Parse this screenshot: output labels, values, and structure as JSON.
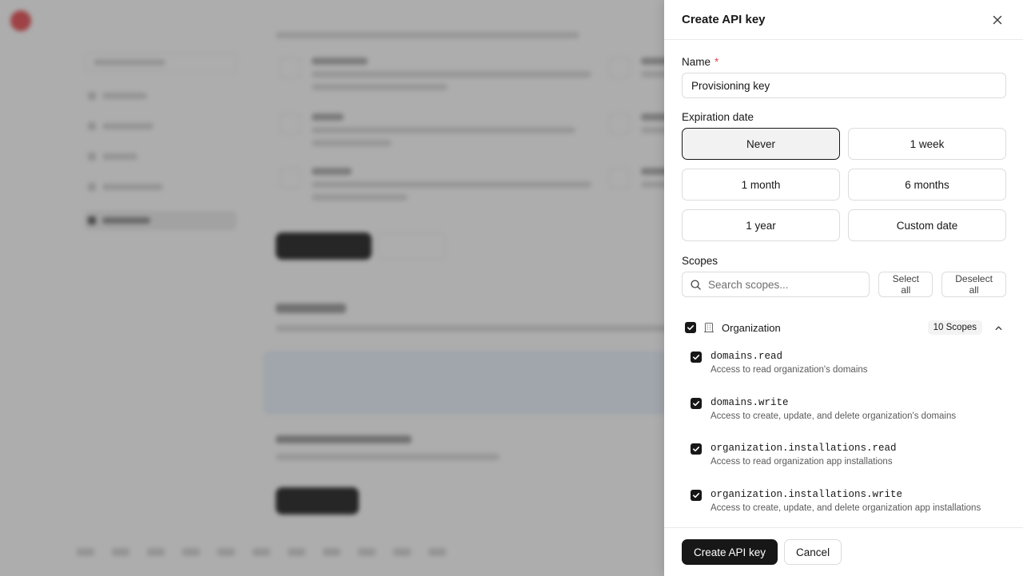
{
  "drawer": {
    "title": "Create API key",
    "close_icon": "close-icon"
  },
  "name_field": {
    "label": "Name",
    "required_mark": "*",
    "value": "Provisioning key"
  },
  "expiration": {
    "label": "Expiration date",
    "options": [
      {
        "label": "Never",
        "selected": true
      },
      {
        "label": "1 week",
        "selected": false
      },
      {
        "label": "1 month",
        "selected": false
      },
      {
        "label": "6 months",
        "selected": false
      },
      {
        "label": "1 year",
        "selected": false
      },
      {
        "label": "Custom date",
        "selected": false
      }
    ]
  },
  "scopes": {
    "label": "Scopes",
    "search_placeholder": "Search scopes...",
    "select_all": "Select all",
    "deselect_all": "Deselect all",
    "group": {
      "name": "Organization",
      "count": "10 Scopes",
      "icon": "building-icon",
      "checked": true,
      "expanded": true,
      "items": [
        {
          "name": "domains.read",
          "description": "Access to read organization's domains",
          "checked": true
        },
        {
          "name": "domains.write",
          "description": "Access to create, update, and delete organization's domains",
          "checked": true
        },
        {
          "name": "organization.installations.read",
          "description": "Access to read organization app installations",
          "checked": true
        },
        {
          "name": "organization.installations.write",
          "description": "Access to create, update, and delete organization app installations",
          "checked": true
        }
      ]
    }
  },
  "footer": {
    "primary": "Create API key",
    "secondary": "Cancel"
  },
  "colors": {
    "primary": "#171717",
    "required": "#e5484d",
    "overlay": "rgba(60,60,60,0.42)"
  }
}
